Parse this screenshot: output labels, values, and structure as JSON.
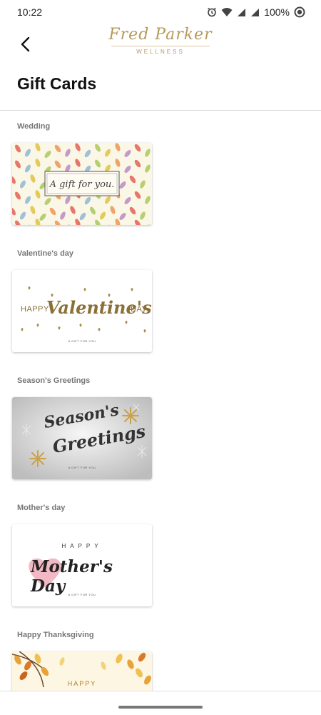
{
  "status_bar": {
    "time": "10:22",
    "battery": "100%",
    "icons": [
      "alarm-icon",
      "wifi-icon",
      "signal-icon",
      "signal-icon",
      "battery-icon"
    ]
  },
  "header": {
    "back_icon": "chevron-left-icon",
    "logo_script": "Fred Parker",
    "logo_sub": "WELLNESS"
  },
  "page": {
    "title": "Gift Cards"
  },
  "sections": [
    {
      "label": "Wedding",
      "card_text": "A gift for you."
    },
    {
      "label": "Valentine's day",
      "card_text_left": "HAPPY",
      "card_text_main": "Valentine's",
      "card_text_right": "DAY",
      "caption": "A GIFT FOR YOU"
    },
    {
      "label": "Season's Greetings",
      "card_text_1": "Season's",
      "card_text_2": "Greetings",
      "caption": "A GIFT FOR YOU"
    },
    {
      "label": "Mother's day",
      "card_text_top": "HAPPY",
      "card_text_main": "Mother's Day",
      "caption": "A GIFT FOR YOU"
    },
    {
      "label": "Happy Thanksgiving",
      "card_text": "HAPPY"
    }
  ],
  "colors": {
    "gold": "#a88a48",
    "label_gray": "#777777",
    "divider": "#d8d8d8"
  }
}
